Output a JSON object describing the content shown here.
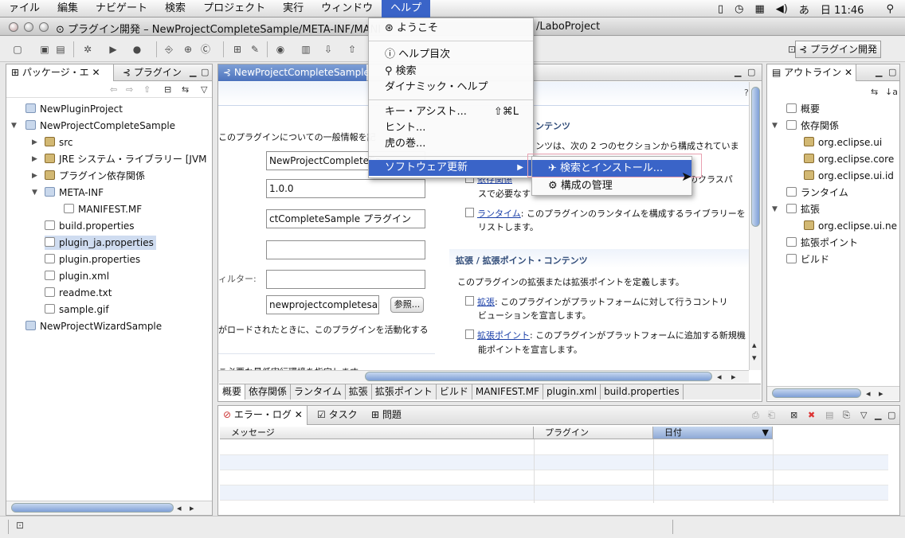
{
  "menubar": {
    "items": [
      "ァイル",
      "編集",
      "ナビゲート",
      "検索",
      "プロジェクト",
      "実行",
      "ウィンドウ",
      "ヘルプ"
    ],
    "clock": "日 11:46"
  },
  "window": {
    "title": "プラグイン開発 – NewProjectCompleteSample/META-INF/MANI",
    "title_tail": "/LaboProject"
  },
  "toolbar": {
    "perspective_label": "プラグイン開発"
  },
  "package_explorer": {
    "tabs": [
      "パッケージ・エ",
      "プラグイン"
    ],
    "tree": [
      "NewPluginProject",
      "NewProjectCompleteSample",
      "src",
      "JRE システム・ライブラリー [JVM",
      "プラグイン依存関係",
      "META-INF",
      "MANIFEST.MF",
      "build.properties",
      "plugin_ja.properties",
      "plugin.properties",
      "plugin.xml",
      "readme.txt",
      "sample.gif",
      "NewProjectWizardSample"
    ]
  },
  "editor": {
    "tab_label": "NewProjectCompleteSample",
    "intro_text": "このプラグインについての一般情報を記",
    "fields": {
      "id": "NewProjectCompleteSa",
      "version": "1.0.0",
      "name": "ctCompleteSample プラグイン",
      "provider": "",
      "platform_filter": "",
      "activator": "newprojectcompletesam|"
    },
    "filter_label": "ィルター:",
    "browse_button": "参照...",
    "activate_text": "がロードされたときに、このプラグインを活動化する",
    "exec_env_text": "こ必要な最低実行環境を指定します",
    "content_heading": "ンテンツ",
    "content_intro": "ンツは、次の 2 つのセクションから構成されていま",
    "dependencies_link": "依存関係",
    "dependencies_text_a": "ンのクラスパ",
    "dependencies_text_b": "スで必要なす",
    "runtime_link": "ランタイム",
    "runtime_text_a": ": このプラグインのランタイムを構成するライブラリーを",
    "runtime_text_b": "リストします。",
    "ext_heading": "拡張 / 拡張ポイント・コンテンツ",
    "ext_intro": "このプラグインの拡張または拡張ポイントを定義します。",
    "ext_link": "拡張",
    "ext_text_a": ": このプラグインがプラットフォームに対して行うコントリ",
    "ext_text_b": "ビューションを宣言します。",
    "extpt_link": "拡張ポイント",
    "extpt_text_a": ": このプラグインがプラットフォームに追加する新規機",
    "extpt_text_b": "能ポイントを宣言します。",
    "bottom_tabs": [
      "概要",
      "依存関係",
      "ランタイム",
      "拡張",
      "拡張ポイント",
      "ビルド",
      "MANIFEST.MF",
      "plugin.xml",
      "build.properties"
    ]
  },
  "outline": {
    "tab": "アウトライン",
    "tree": [
      "概要",
      "依存関係",
      "org.eclipse.ui",
      "org.eclipse.core",
      "org.eclipse.ui.id",
      "ランタイム",
      "拡張",
      "org.eclipse.ui.ne",
      "拡張ポイント",
      "ビルド"
    ]
  },
  "error_log": {
    "tabs": [
      "エラー・ログ",
      "タスク",
      "問題"
    ],
    "columns": [
      "メッセージ",
      "プラグイン",
      "日付"
    ]
  },
  "help_menu": {
    "welcome": "ようこそ",
    "contents": "ヘルプ目次",
    "search": "検索",
    "dynamic_help": "ダイナミック・ヘルプ",
    "key_assist": "キー・アシスト...",
    "key_assist_shortcut": "⇧⌘L",
    "tips": "ヒント...",
    "cheat_sheets": "虎の巻...",
    "software_updates": "ソフトウェア更新"
  },
  "submenu": {
    "find_install": "検索とインストール...",
    "manage_config": "構成の管理"
  },
  "colors": {
    "selection": "#3a64c8",
    "link": "#1a3fa8"
  }
}
